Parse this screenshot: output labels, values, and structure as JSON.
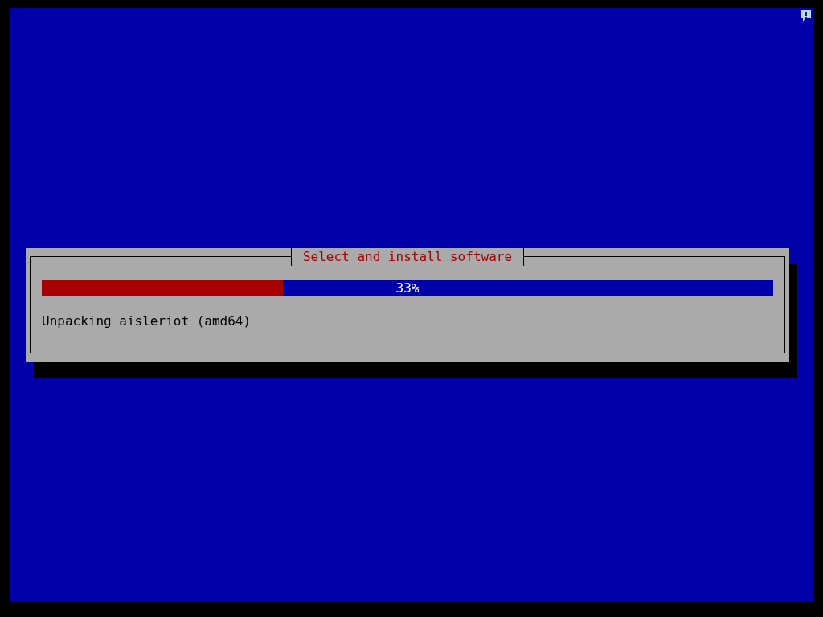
{
  "dialog": {
    "title": "Select and install software",
    "progress": {
      "level": 0.33,
      "reading": "33%"
    },
    "status": "Unpacking aisleriot (amd64)"
  }
}
